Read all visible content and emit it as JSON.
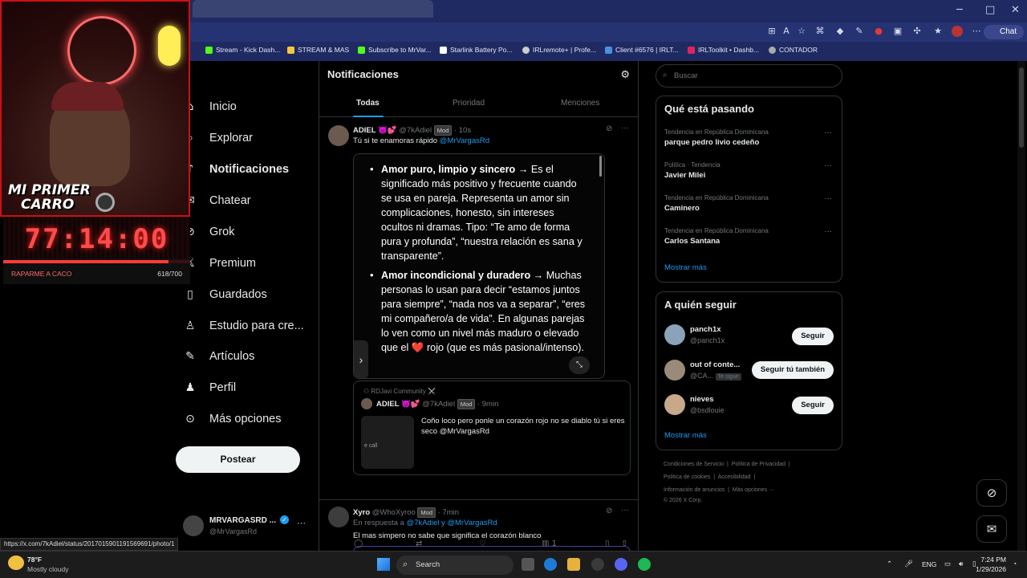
{
  "browser": {
    "chat_label": "Chat",
    "bookmarks": [
      {
        "label": "Stream - Kick Dash...",
        "color": "#53fc18"
      },
      {
        "label": "STREAM & MAS",
        "color": "#f5c842"
      },
      {
        "label": "Subscribe to MrVar...",
        "color": "#53fc18"
      },
      {
        "label": "Starlink Battery Po...",
        "color": "#ffffff"
      },
      {
        "label": "IRLremote+ | Profe...",
        "color": "#cccccc"
      },
      {
        "label": "Client #6576 | IRLT...",
        "color": "#4a90e2"
      },
      {
        "label": "IRLToolkit • Dashb...",
        "color": "#e0245e"
      },
      {
        "label": "CONTADOR",
        "color": "#aaaaaa"
      }
    ],
    "status_url": "https://x.com/7kAdiel/status/2017015901191569691/photo/1"
  },
  "overlay": {
    "logo_line1": "MI PRIMER",
    "logo_line2": "CARRO",
    "timer": "77:14:00",
    "goal_label": "RAPARME A CACO",
    "goal_count": "618/700",
    "progress": 0.883
  },
  "nav": {
    "items": [
      {
        "label": "Inicio",
        "icon": "home-icon"
      },
      {
        "label": "Explorar",
        "icon": "search-icon"
      },
      {
        "label": "Notificaciones",
        "icon": "bell-icon"
      },
      {
        "label": "Chatear",
        "icon": "mail-icon"
      },
      {
        "label": "Grok",
        "icon": "grok-icon"
      },
      {
        "label": "Premium",
        "icon": "x-icon"
      },
      {
        "label": "Guardados",
        "icon": "bookmark-icon"
      },
      {
        "label": "Estudio para cre...",
        "icon": "studio-icon"
      },
      {
        "label": "Artículos",
        "icon": "article-icon"
      },
      {
        "label": "Perfil",
        "icon": "person-icon"
      },
      {
        "label": "Más opciones",
        "icon": "more-icon"
      }
    ],
    "post_label": "Postear",
    "account_name": "MRVARGASRD ...",
    "account_handle": "@MrVargasRd"
  },
  "notifications": {
    "title": "Notificaciones",
    "tabs": [
      "Todas",
      "Prioridad",
      "Menciones"
    ],
    "tweet1": {
      "name": "ADIEL 😈💕",
      "handle": "@7kAdiel",
      "badge": "Mod",
      "time": "10s",
      "text": "Tú si te enamoras rápido",
      "mention": "@MrVargasRd",
      "image_items": [
        {
          "bold": "Amor puro, limpio y sincero",
          "rest": " → Es el significado más positivo y frecuente cuando se usa en pareja. Representa un amor sin complicaciones, honesto, sin intereses ocultos ni dramas. Tipo: “Te amo de forma pura y profunda”, “nuestra relación es sana y transparente”."
        },
        {
          "bold": "Amor incondicional y duradero",
          "rest": " → Muchas personas lo usan para decir “estamos juntos para siempre”, “nada nos va a separar”, “eres mi compañero/a de vida”. En algunas parejas lo ven como un nivel más maduro o elevado que el ❤️ rojo (que es más pasional/intenso)."
        }
      ],
      "quote": {
        "community": "RDJavi Community ⚔️",
        "name": "ADIEL 😈💕",
        "handle": "@7kAdiel",
        "badge": "Mod",
        "time": "9min",
        "text": "Coño loco pero ponle un corazón rojo no se diablo tú si eres seco @MrVargasRd",
        "thumb_text": "e call"
      },
      "views": "1"
    },
    "tweet2": {
      "name": "Xyro",
      "handle": "@WhoXyroo",
      "badge": "Mod",
      "time": "7min",
      "reply_prefix": "En respuesta a",
      "reply_to": "@7kAdiel y @MrVargasRd",
      "text": "El mas simpero no sabe que significa el corazón blanco"
    }
  },
  "sidebar": {
    "search_placeholder": "Buscar",
    "trends_title": "Qué está pasando",
    "trends": [
      {
        "context": "Tendencia en República Dominicana",
        "name": "parque pedro livio cedeño"
      },
      {
        "context": "Política · Tendencia",
        "name": "Javier Milei"
      },
      {
        "context": "Tendencia en República Dominicana",
        "name": "Caminero"
      },
      {
        "context": "Tendencia en República Dominicana",
        "name": "Carlos Santana"
      }
    ],
    "show_more": "Mostrar más",
    "follow_title": "A quién seguir",
    "follow": [
      {
        "name": "panch1x",
        "handle": "@panch1x",
        "button": "Seguir",
        "follows_you": ""
      },
      {
        "name": "out of conte...",
        "handle": "@CA...",
        "button": "Seguir tú también",
        "follows_you": "Te sigue"
      },
      {
        "name": "nieves",
        "handle": "@bsdlouie",
        "button": "Seguir",
        "follows_you": ""
      }
    ],
    "footer": [
      "Condiciones de Servicio",
      "Política de Privacidad",
      "Política de cookies",
      "Accesibilidad",
      "Información de anuncios",
      "Más opciones ···",
      "© 2026 X Corp."
    ]
  },
  "taskbar": {
    "weather_temp": "78°F",
    "weather_desc": "Mostly cloudy",
    "search_label": "Search",
    "lang": "ENG",
    "time": "7:24 PM",
    "date": "1/29/2026"
  }
}
